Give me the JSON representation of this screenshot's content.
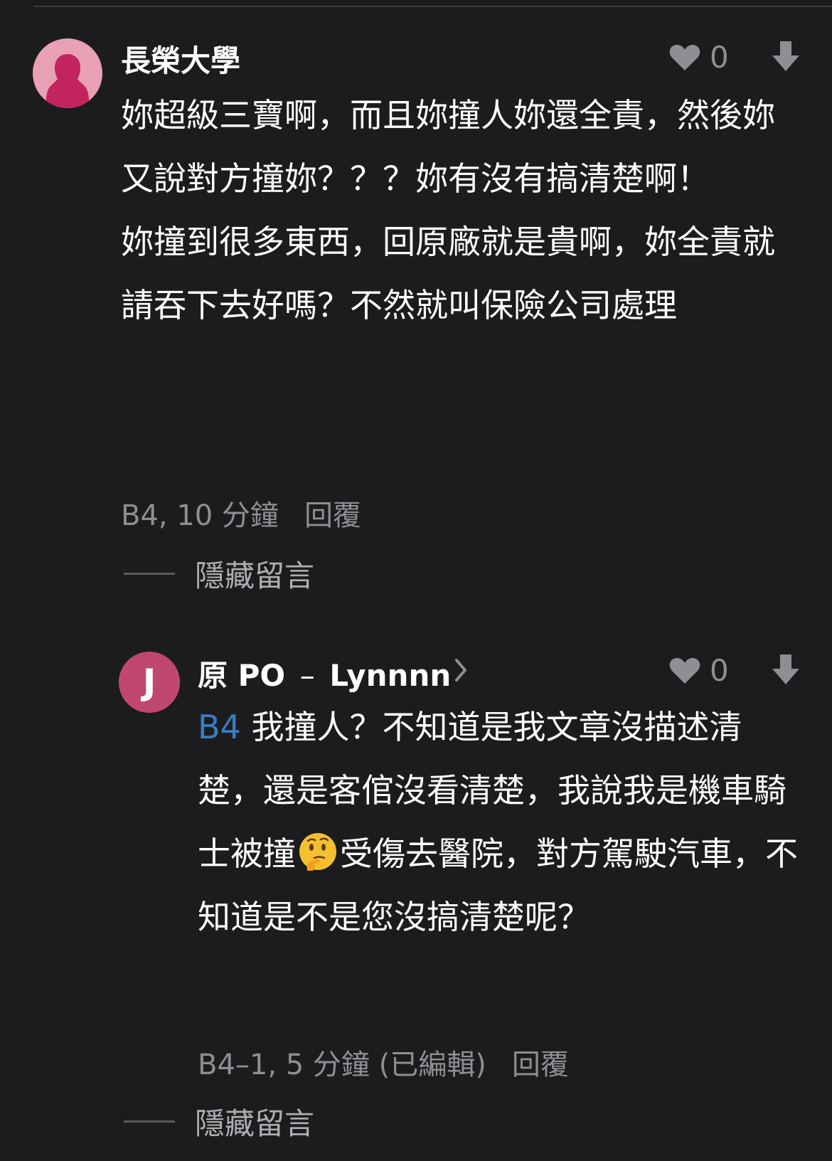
{
  "comments": [
    {
      "author": "長榮大學",
      "likes": "0",
      "paragraphs": [
        "妳超級三寶啊，而且妳撞人妳還全責，然後妳又說對方撞妳？？？妳有沒有搞清楚啊！",
        "妳撞到很多東西，回原廠就是貴啊，妳全責就請吞下去好嗎？不然就叫保險公司處理"
      ],
      "meta": "B4, 10 分鐘",
      "reply_label": "回覆",
      "hide_label": "隱藏留言"
    },
    {
      "avatar_letter": "J",
      "author_prefix": "原 PO",
      "author_sep": "–",
      "author_name": "Lynnnn",
      "likes": "0",
      "reply_ref": "B4",
      "text_part1": "我撞人？不知道是我文章沒描述清楚，還是客倌沒看清楚，我說我是機車騎士被撞",
      "emoji_name": "thinking-face-emoji",
      "text_part2": "受傷去醫院，對方駕駛汽車，不知道是不是您沒搞清楚呢？",
      "meta": "B4–1, 5 分鐘 (已編輯)",
      "reply_label": "回覆",
      "hide_label": "隱藏留言"
    }
  ],
  "colors": {
    "background": "#1c1c1e",
    "text": "#ffffff",
    "muted": "#8e8e93",
    "link": "#3a7cc0",
    "avatar_female": "#e8a0b4",
    "avatar_j": "#c0476f"
  }
}
